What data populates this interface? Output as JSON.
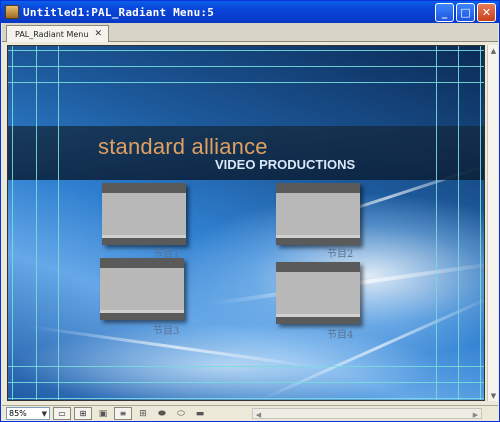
{
  "window": {
    "title": "Untitled1:PAL_Radiant Menu:5",
    "buttons": {
      "minimize": "_",
      "maximize": "□",
      "close": "✕"
    }
  },
  "tabs": [
    {
      "label": "PAL_Radiant Menu",
      "close": "✕"
    }
  ],
  "menu": {
    "title": "standard alliance",
    "subtitle": "VIDEO PRODUCTIONS",
    "buttons": [
      {
        "label": "节目1"
      },
      {
        "label": "节目2"
      },
      {
        "label": "节目3"
      },
      {
        "label": "节目4"
      }
    ]
  },
  "statusbar": {
    "zoom": "85%",
    "zoom_arrow": "▼",
    "icons": [
      "view-normal-icon",
      "view-safe-area-icon",
      "display-icon",
      "list-icon",
      "add-button-icon",
      "button-shape-1-icon",
      "button-shape-2-icon",
      "button-shape-3-icon"
    ]
  },
  "colors": {
    "title_text": "#e0a060",
    "subtitle_text": "#d8e8f8",
    "label_text": "#5a7090",
    "guide": "#78dcdc"
  }
}
